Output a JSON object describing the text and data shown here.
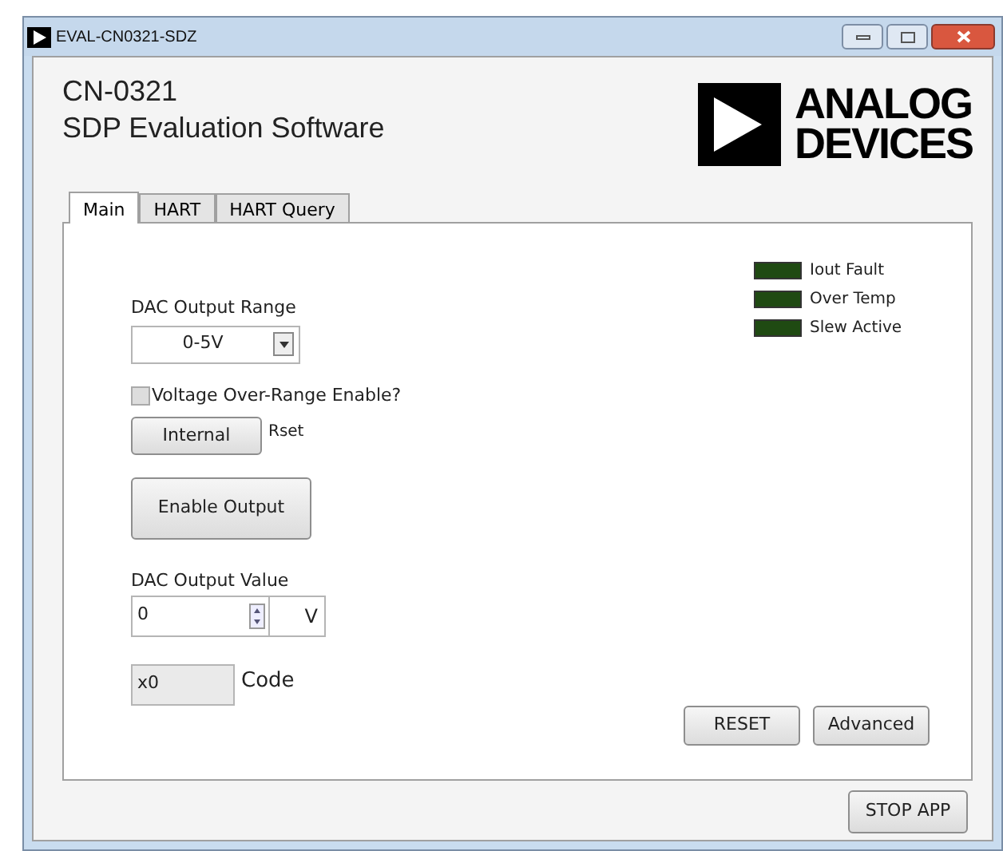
{
  "window": {
    "title": "EVAL-CN0321-SDZ"
  },
  "header": {
    "title": "CN-0321",
    "subtitle": "SDP Evaluation Software",
    "logo_text": [
      "ANALOG",
      "DEVICES"
    ]
  },
  "tabs": [
    {
      "label": "Main",
      "selected": true
    },
    {
      "label": "HART",
      "selected": false
    },
    {
      "label": "HART Query",
      "selected": false
    }
  ],
  "indicators": [
    {
      "label": "Iout Fault",
      "on": false
    },
    {
      "label": "Over Temp",
      "on": false
    },
    {
      "label": "Slew Active",
      "on": false
    }
  ],
  "range": {
    "label": "DAC Output Range",
    "value": "0-5V"
  },
  "over_range": {
    "label": "Voltage Over-Range Enable?",
    "checked": false
  },
  "rset": {
    "button": "Internal",
    "label": "Rset"
  },
  "enable_button": "Enable Output",
  "output_value": {
    "label": "DAC Output Value",
    "value": "0",
    "unit": "V"
  },
  "code": {
    "value": "x0",
    "label": "Code"
  },
  "buttons": [
    "RESET",
    "Advanced"
  ],
  "stop_button": "STOP APP"
}
